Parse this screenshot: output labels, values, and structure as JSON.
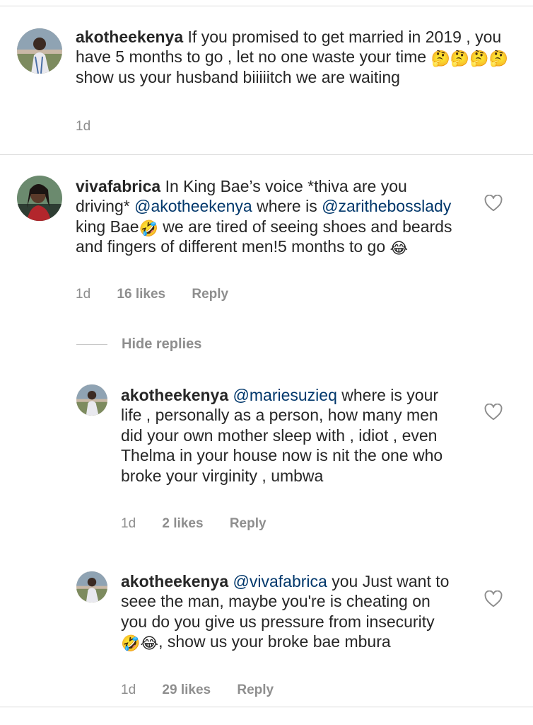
{
  "comments": [
    {
      "username": "akotheekenya",
      "text_before": " If you promised to get married in 2019 , you have 5 months to go , let no one waste your time ",
      "emojis": "🤔🤔🤔🤔",
      "text_after": " show us your husband biiiiitch we are waiting",
      "time": "1d",
      "avatar_icon": "profile-photo-icon"
    },
    {
      "username": "vivafabrica",
      "text_1": " In King Bae’s voice *thiva are you driving* ",
      "mention_1": "@akotheekenya",
      "text_2": " where is ",
      "mention_2": "@zarithebosslady",
      "text_3": " king Bae",
      "emoji_1": "🤣",
      "text_4": " we are tired of seeing shoes and beards and fingers of different men!5 months to go ",
      "emoji_2": "😂",
      "time": "1d",
      "likes": "16 likes",
      "reply": "Reply",
      "avatar_icon": "profile-photo-icon"
    }
  ],
  "hide_replies_label": "Hide replies",
  "replies": [
    {
      "username": "akotheekenya",
      "mention": "@mariesuzieq",
      "text": " where is your life , personally as a person, how many men did your own mother sleep with , idiot , even Thelma in your house now is nit the one who broke your virginity , umbwa",
      "time": "1d",
      "likes": "2 likes",
      "reply": "Reply"
    },
    {
      "username": "akotheekenya",
      "mention": "@vivafabrica",
      "text_1": " you Just want to seee the man, maybe you're is cheating on you do you give us pressure from insecurity ",
      "emojis": "🤣😂",
      "text_2": ", show us your broke bae mbura",
      "time": "1d",
      "likes": "29 likes",
      "reply": "Reply"
    }
  ],
  "colors": {
    "mention": "#00376b",
    "meta": "#8e8e8e",
    "divider": "#dbdbdb"
  },
  "icons": {
    "like": "heart-outline-icon"
  }
}
